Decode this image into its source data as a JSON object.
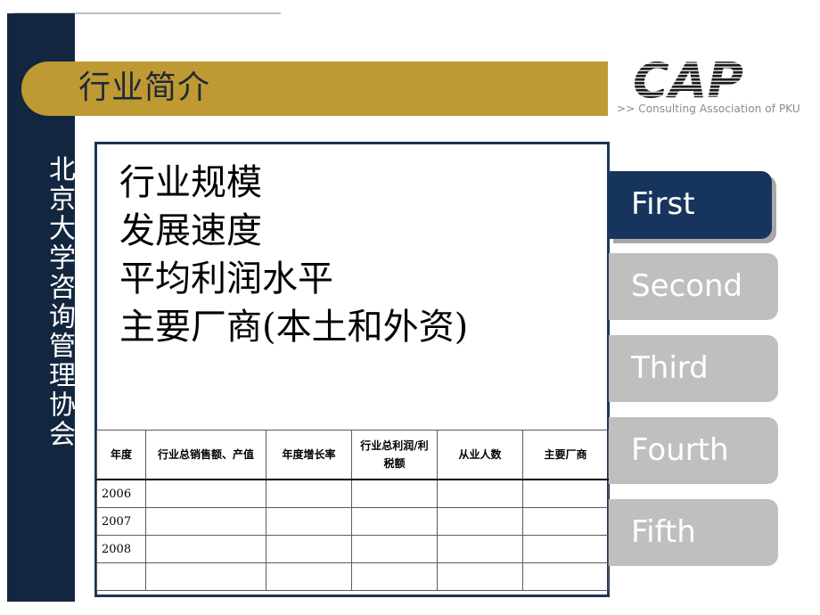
{
  "header": {
    "title": "行业简介",
    "banner_color": "#bf9a33"
  },
  "sidebar": {
    "text": "北京大学咨询管理协会",
    "color": "#13263f"
  },
  "logo": {
    "mark": "CAP",
    "subtitle": ">> Consulting Association of PKU"
  },
  "main": {
    "points": [
      "行业规模",
      "发展速度",
      "平均利润水平",
      "主要厂商(本土和外资)"
    ],
    "table": {
      "headers": [
        "年度",
        "行业总销售额、产值",
        "年度增长率",
        "行业总利润/利税额",
        "从业人数",
        "主要厂商"
      ],
      "rows": [
        [
          "2006",
          "",
          "",
          "",
          "",
          ""
        ],
        [
          "2007",
          "",
          "",
          "",
          "",
          ""
        ],
        [
          "2008",
          "",
          "",
          "",
          "",
          ""
        ],
        [
          "",
          "",
          "",
          "",
          "",
          ""
        ]
      ]
    }
  },
  "tabs": [
    {
      "label": "First",
      "active": true
    },
    {
      "label": "Second",
      "active": false
    },
    {
      "label": "Third",
      "active": false
    },
    {
      "label": "Fourth",
      "active": false
    },
    {
      "label": "Fifth",
      "active": false
    }
  ],
  "colors": {
    "accent_navy": "#17355c",
    "tab_inactive": "#bfbfbf"
  }
}
